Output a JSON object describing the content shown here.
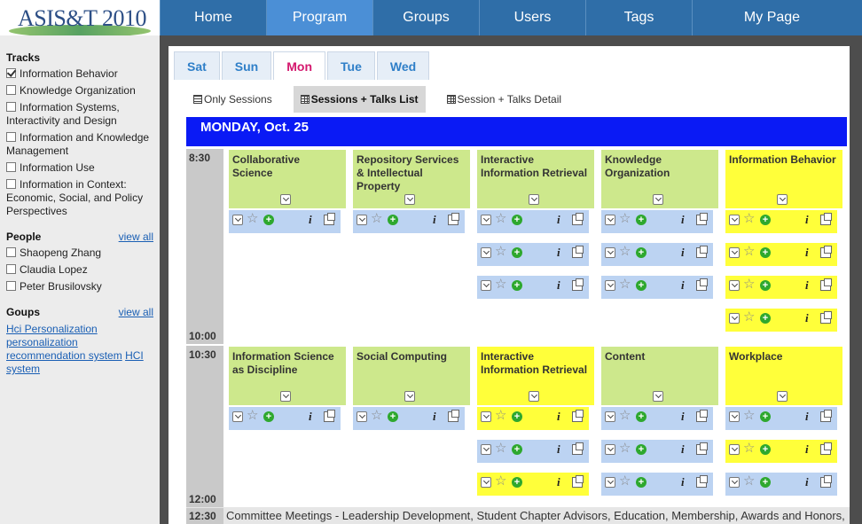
{
  "logo": {
    "text": "ASIS&T 2010"
  },
  "nav": [
    "Home",
    "Program",
    "Groups",
    "Users",
    "Tags",
    "My Page"
  ],
  "nav_active": "Program",
  "sidebar": {
    "tracks_heading": "Tracks",
    "tracks": [
      {
        "label": "Information Behavior",
        "checked": true
      },
      {
        "label": "Knowledge Organization",
        "checked": false
      },
      {
        "label": "Information Systems, Interactivity and Design",
        "checked": false
      },
      {
        "label": "Information and Knowledge Management",
        "checked": false
      },
      {
        "label": "Information Use",
        "checked": false
      },
      {
        "label": "Information in Context: Economic, Social, and Policy Perspectives",
        "checked": false
      }
    ],
    "people_heading": "People",
    "people_view_all": "view all",
    "people": [
      "Shaopeng Zhang",
      "Claudia Lopez",
      "Peter Brusilovsky"
    ],
    "groups_heading": "Goups",
    "groups_view_all": "view all",
    "groups_tags": [
      "Hci Personalization",
      "personalization",
      "recommendation system",
      "HCI",
      "system"
    ]
  },
  "day_tabs": [
    "Sat",
    "Sun",
    "Mon",
    "Tue",
    "Wed"
  ],
  "day_active": "Mon",
  "views": {
    "only_sessions": "Only Sessions",
    "sessions_talks_list": "Sessions + Talks List",
    "session_talks_detail": "Session + Talks Detail"
  },
  "day_header": "MONDAY, Oct. 25",
  "block1": {
    "start": "8:30",
    "end": "10:00",
    "sessions": [
      {
        "title": "Collaborative Science",
        "color": "green"
      },
      {
        "title": "Repository Services & Intellectual Property",
        "color": "green"
      },
      {
        "title": "Interactive Information Retrieval",
        "color": "green"
      },
      {
        "title": "Knowledge Organization",
        "color": "green"
      },
      {
        "title": "Information Behavior",
        "color": "yellow"
      }
    ]
  },
  "block2": {
    "start": "10:30",
    "end": "12:00",
    "sessions": [
      {
        "title": "Information Science as Discipline",
        "color": "green"
      },
      {
        "title": "Social Computing",
        "color": "green"
      },
      {
        "title": "Interactive Information Retrieval",
        "color": "yellow"
      },
      {
        "title": "Content",
        "color": "green"
      },
      {
        "title": "Workplace",
        "color": "yellow"
      }
    ]
  },
  "footer": {
    "time": "12:30",
    "text": "Committee Meetings - Leadership Development, Student Chapter Advisors, Education, Membership, Awards and Honors,"
  },
  "colors": {
    "nav": "#2f6ea8",
    "nav_active": "#4b8fd6",
    "day_header": "#0a1af5",
    "session_green": "#cde88c",
    "session_yellow": "#ffff3a",
    "talk_blue": "#bcd3f2",
    "tab_active": "#d4176d"
  },
  "icons": [
    "expand-icon",
    "star-icon",
    "add-icon",
    "info-icon",
    "popout-icon",
    "checkbox-icon",
    "list-icon",
    "grid-icon"
  ]
}
